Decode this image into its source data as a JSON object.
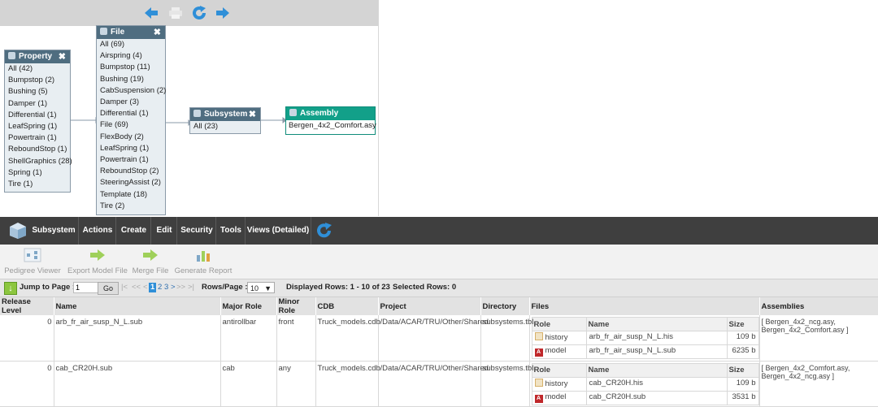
{
  "nav": {
    "icons": [
      "back-arrow-icon",
      "print-icon",
      "refresh-icon",
      "forward-arrow-icon"
    ]
  },
  "panels": {
    "property": {
      "title": "Property",
      "items": [
        "All (42)",
        "Bumpstop (2)",
        "Bushing (5)",
        "Damper (1)",
        "Differential (1)",
        "LeafSpring (1)",
        "Powertrain (1)",
        "ReboundStop (1)",
        "ShellGraphics (28)",
        "Spring (1)",
        "Tire (1)"
      ]
    },
    "file": {
      "title": "File",
      "items": [
        "All (69)",
        "Airspring (4)",
        "Bumpstop (11)",
        "Bushing (19)",
        "CabSuspension (2)",
        "Damper (3)",
        "Differential (1)",
        "File (69)",
        "FlexBody (2)",
        "LeafSpring (1)",
        "Powertrain (1)",
        "ReboundStop (2)",
        "SteeringAssist (2)",
        "Template (18)",
        "Tire (2)"
      ]
    },
    "subsystem": {
      "title": "Subsystem",
      "items": [
        "All (23)"
      ]
    },
    "assembly": {
      "title": "Assembly",
      "items": [
        "Bergen_4x2_Comfort.asy"
      ]
    }
  },
  "menubar": {
    "items": [
      "Subsystem",
      "Actions",
      "Create",
      "Edit",
      "Security",
      "Tools",
      "Views (Detailed)"
    ]
  },
  "toolbar": {
    "items": [
      "Pedigree Viewer",
      "Export Model File",
      "Merge File",
      "Generate Report"
    ]
  },
  "pager": {
    "jump_label": "Jump to Page :",
    "jump_value": "1",
    "go_label": "Go",
    "first": "|<",
    "prev_fast": "<<",
    "prev": "<",
    "page1": "1",
    "page2": "2",
    "page3": "3",
    "next": ">",
    "next_fast": ">>",
    "last": ">|",
    "rows_label": "Rows/Page :",
    "rows_value": "10",
    "displayed": "Displayed Rows: 1 - 10 of 23",
    "selected": "Selected Rows: 0"
  },
  "grid": {
    "headers": [
      "Release Level",
      "Name",
      "Major Role",
      "Minor Role",
      "CDB",
      "Project",
      "Directory",
      "Files",
      "Assemblies"
    ],
    "file_headers": [
      "Role",
      "Name",
      "Size"
    ],
    "rows": [
      {
        "release": "0",
        "name": "arb_fr_air_susp_N_L.sub",
        "major": "antirollbar",
        "minor": "front",
        "cdb": "Truck_models.cdb",
        "project": "/Data/ACAR/TRU/Other/Shared",
        "directory": "subsystems.tbl",
        "files": [
          {
            "role": "history",
            "name": "arb_fr_air_susp_N_L.his",
            "size": "109 b"
          },
          {
            "role": "model",
            "name": "arb_fr_air_susp_N_L.sub",
            "size": "6235 b"
          }
        ],
        "assemblies": "[ Bergen_4x2_ncg.asy, Bergen_4x2_Comfort.asy ]"
      },
      {
        "release": "0",
        "name": "cab_CR20H.sub",
        "major": "cab",
        "minor": "any",
        "cdb": "Truck_models.cdb",
        "project": "/Data/ACAR/TRU/Other/Shared",
        "directory": "subsystems.tbl",
        "files": [
          {
            "role": "history",
            "name": "cab_CR20H.his",
            "size": "109 b"
          },
          {
            "role": "model",
            "name": "cab_CR20H.sub",
            "size": "3531 b"
          }
        ],
        "assemblies": "[ Bergen_4x2_Comfort.asy, Bergen_4x2_ncg.asy ]"
      }
    ]
  },
  "colors": {
    "panel_header": "#4f6d80",
    "assembly_header": "#12a089",
    "menubar": "#3f3f3f",
    "accent_blue": "#2f8fd8",
    "toolbar_green": "#8cc63f"
  }
}
